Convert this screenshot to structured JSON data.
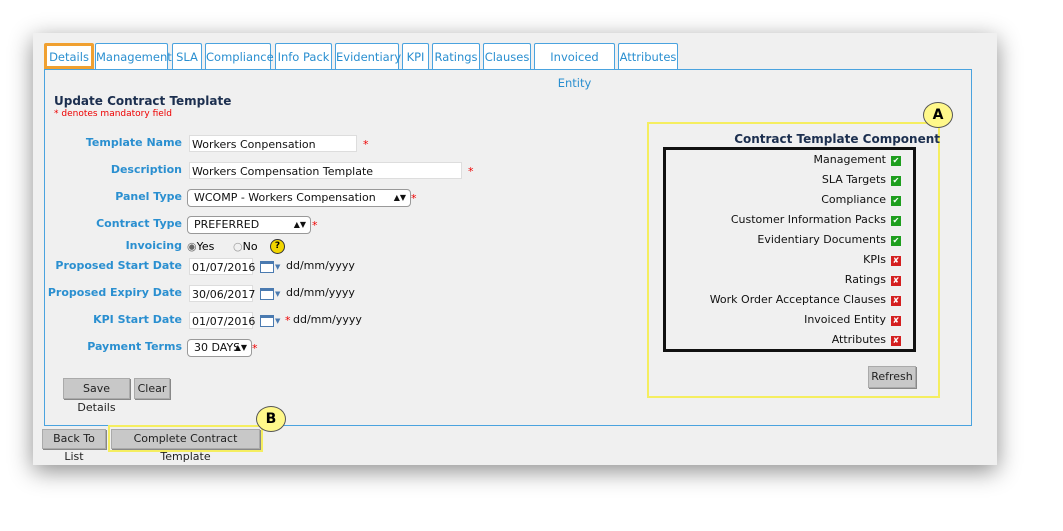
{
  "tabs": [
    "Details",
    "Management",
    "SLA",
    "Compliance",
    "Info Pack",
    "Evidentiary",
    "KPI",
    "Ratings",
    "Clauses",
    "Invoiced Entity",
    "Attributes"
  ],
  "active_tab": "Details",
  "form": {
    "title": "Update Contract Template",
    "mandatory_note": "* denotes mandatory field",
    "template_name_label": "Template Name",
    "template_name": "Workers Conpensation",
    "description_label": "Description",
    "description": "Workers Compensation Template",
    "panel_type_label": "Panel Type",
    "panel_type": "WCOMP - Workers Compensation",
    "contract_type_label": "Contract Type",
    "contract_type": "PREFERRED",
    "invoicing_label": "Invoicing",
    "invoicing_yes": "Yes",
    "invoicing_no": "No",
    "invoicing_value": "Yes",
    "start_date_label": "Proposed Start Date",
    "start_date": "01/07/2016",
    "expiry_date_label": "Proposed Expiry Date",
    "expiry_date": "30/06/2017",
    "kpi_date_label": "KPI Start Date",
    "kpi_date": "01/07/2016",
    "date_format": "dd/mm/yyyy",
    "payment_terms_label": "Payment Terms",
    "payment_terms": "30 DAYS",
    "required_marker": "*",
    "help_icon": "?",
    "save_label": "Save Details",
    "clear_label": "Clear"
  },
  "components": {
    "title": "Contract Template Component",
    "items": [
      {
        "label": "Management",
        "done": true
      },
      {
        "label": "SLA Targets",
        "done": true
      },
      {
        "label": "Compliance",
        "done": true
      },
      {
        "label": "Customer Information Packs",
        "done": true
      },
      {
        "label": "Evidentiary Documents",
        "done": true
      },
      {
        "label": "KPIs",
        "done": false
      },
      {
        "label": "Ratings",
        "done": false
      },
      {
        "label": "Work Order Acceptance Clauses",
        "done": false
      },
      {
        "label": "Invoiced Entity",
        "done": false
      },
      {
        "label": "Attributes",
        "done": false
      }
    ],
    "refresh_label": "Refresh",
    "colors": {
      "done": "#1e9e1e",
      "missing": "#d41f1f"
    }
  },
  "footer": {
    "back_label": "Back To List",
    "complete_label": "Complete Contract Template"
  },
  "callouts": {
    "a": "A",
    "b": "B"
  }
}
